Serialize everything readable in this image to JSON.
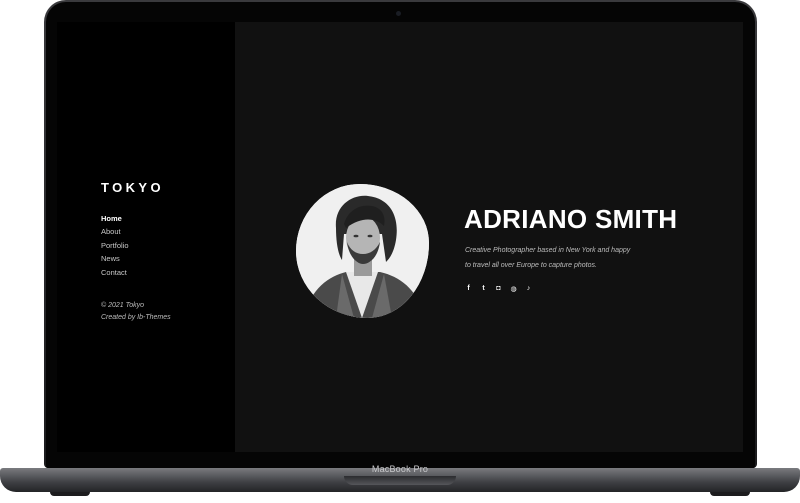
{
  "sidebar": {
    "logo": "TOKYO",
    "nav": [
      {
        "label": "Home",
        "active": true
      },
      {
        "label": "About",
        "active": false
      },
      {
        "label": "Portfolio",
        "active": false
      },
      {
        "label": "News",
        "active": false
      },
      {
        "label": "Contact",
        "active": false
      }
    ],
    "copyright": "© 2021 Tokyo",
    "created_by": "Created by Ib-Themes"
  },
  "hero": {
    "name": "ADRIANO SMITH",
    "bio_line1": "Creative Photographer based in New York and happy",
    "bio_line2": "to travel all over Europe to capture photos.",
    "socials": [
      {
        "icon": "facebook-icon",
        "glyph": "f"
      },
      {
        "icon": "twitter-icon",
        "glyph": "t"
      },
      {
        "icon": "instagram-icon",
        "glyph": "◘"
      },
      {
        "icon": "dribbble-icon",
        "glyph": "◍"
      },
      {
        "icon": "tiktok-icon",
        "glyph": "♪"
      }
    ]
  },
  "device": {
    "label": "MacBook Pro"
  },
  "colors": {
    "sidebar_bg": "#000000",
    "main_bg": "#111111",
    "text_primary": "#ffffff",
    "text_muted": "#bdbdbd"
  }
}
